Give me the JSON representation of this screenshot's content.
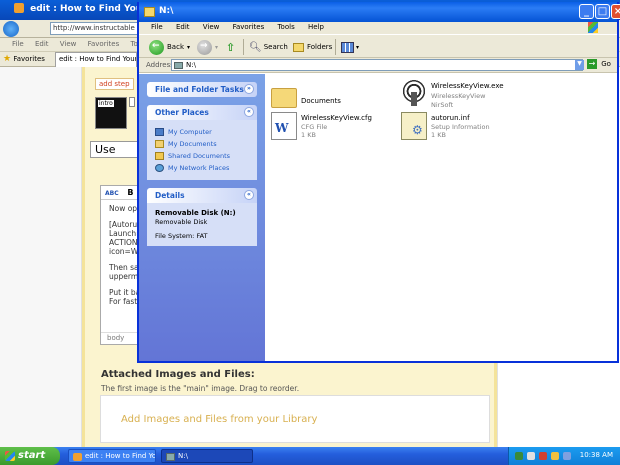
{
  "ie": {
    "title": "edit : How to Find Your Lost Wi",
    "address": "http://www.instructable",
    "menu": [
      "File",
      "Edit",
      "View",
      "Favorites",
      "Tools"
    ],
    "favorites_label": "Favorites",
    "tab_label": "edit : How to Find Your",
    "add_step": "add step",
    "thumb_label": "intro",
    "step_title": "Use",
    "editor_tool_b": "B",
    "editor_lines": [
      "Now ope",
      "[Autorun",
      "Launch=",
      "ACTION",
      "icon=Wi",
      "Then sa",
      "uppermo",
      "Put it ba",
      "For fast"
    ],
    "editor_status": "body",
    "attached_title": "Attached Images and Files:",
    "attached_sub": "The first image is the \"main\" image. Drag to reorder.",
    "add_files": "Add Images and Files from your Library"
  },
  "explorer": {
    "title": "N:\\",
    "menu": [
      "File",
      "Edit",
      "View",
      "Favorites",
      "Tools",
      "Help"
    ],
    "toolbar": {
      "back": "Back",
      "search": "Search",
      "folders": "Folders"
    },
    "address_label": "Address",
    "address_value": "N:\\",
    "go_label": "Go",
    "panels": {
      "tasks_title": "File and Folder Tasks",
      "other_title": "Other Places",
      "other_links": [
        "My Computer",
        "My Documents",
        "Shared Documents",
        "My Network Places"
      ],
      "details_title": "Details",
      "details_name": "Removable Disk (N:)",
      "details_type": "Removable Disk",
      "details_fs": "File System: FAT"
    },
    "files": [
      {
        "name": "Documents",
        "sub1": "",
        "sub2": "",
        "icon": "folder-icon"
      },
      {
        "name": "WirelessKeyView.exe",
        "sub1": "WirelessKeyView",
        "sub2": "NirSoft",
        "icon": "exe-icon"
      },
      {
        "name": "WirelessKeyView.cfg",
        "sub1": "CFG File",
        "sub2": "1 KB",
        "icon": "word-doc-icon"
      },
      {
        "name": "autorun.inf",
        "sub1": "Setup Information",
        "sub2": "1 KB",
        "icon": "inf-icon"
      }
    ]
  },
  "taskbar": {
    "start": "start",
    "items": [
      "edit : How to Find Yo...",
      "N:\\"
    ],
    "clock": "10:38 AM"
  }
}
